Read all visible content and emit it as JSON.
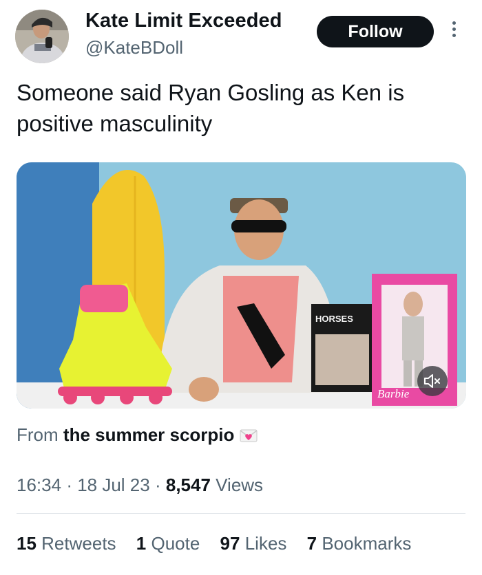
{
  "author": {
    "name": "Kate Limit Exceeded",
    "handle": "@KateBDoll"
  },
  "follow_label": "Follow",
  "tweet_text": "Someone said Ryan Gosling as Ken is positive masculinity",
  "media": {
    "book_title": "HORSES",
    "doll_box_brand": "Barbie"
  },
  "source": {
    "prefix": "From",
    "name": "the summer scorpio"
  },
  "meta": {
    "time": "16:34",
    "date": "18 Jul 23",
    "views_count": "8,547",
    "views_label": "Views"
  },
  "stats": [
    {
      "count": "15",
      "label": "Retweets"
    },
    {
      "count": "1",
      "label": "Quote"
    },
    {
      "count": "97",
      "label": "Likes"
    },
    {
      "count": "7",
      "label": "Bookmarks"
    }
  ],
  "colors": {
    "primary_text": "#0f1419",
    "secondary_text": "#536471",
    "follow_button": "#0f1419",
    "divider": "#e1e6ea"
  }
}
